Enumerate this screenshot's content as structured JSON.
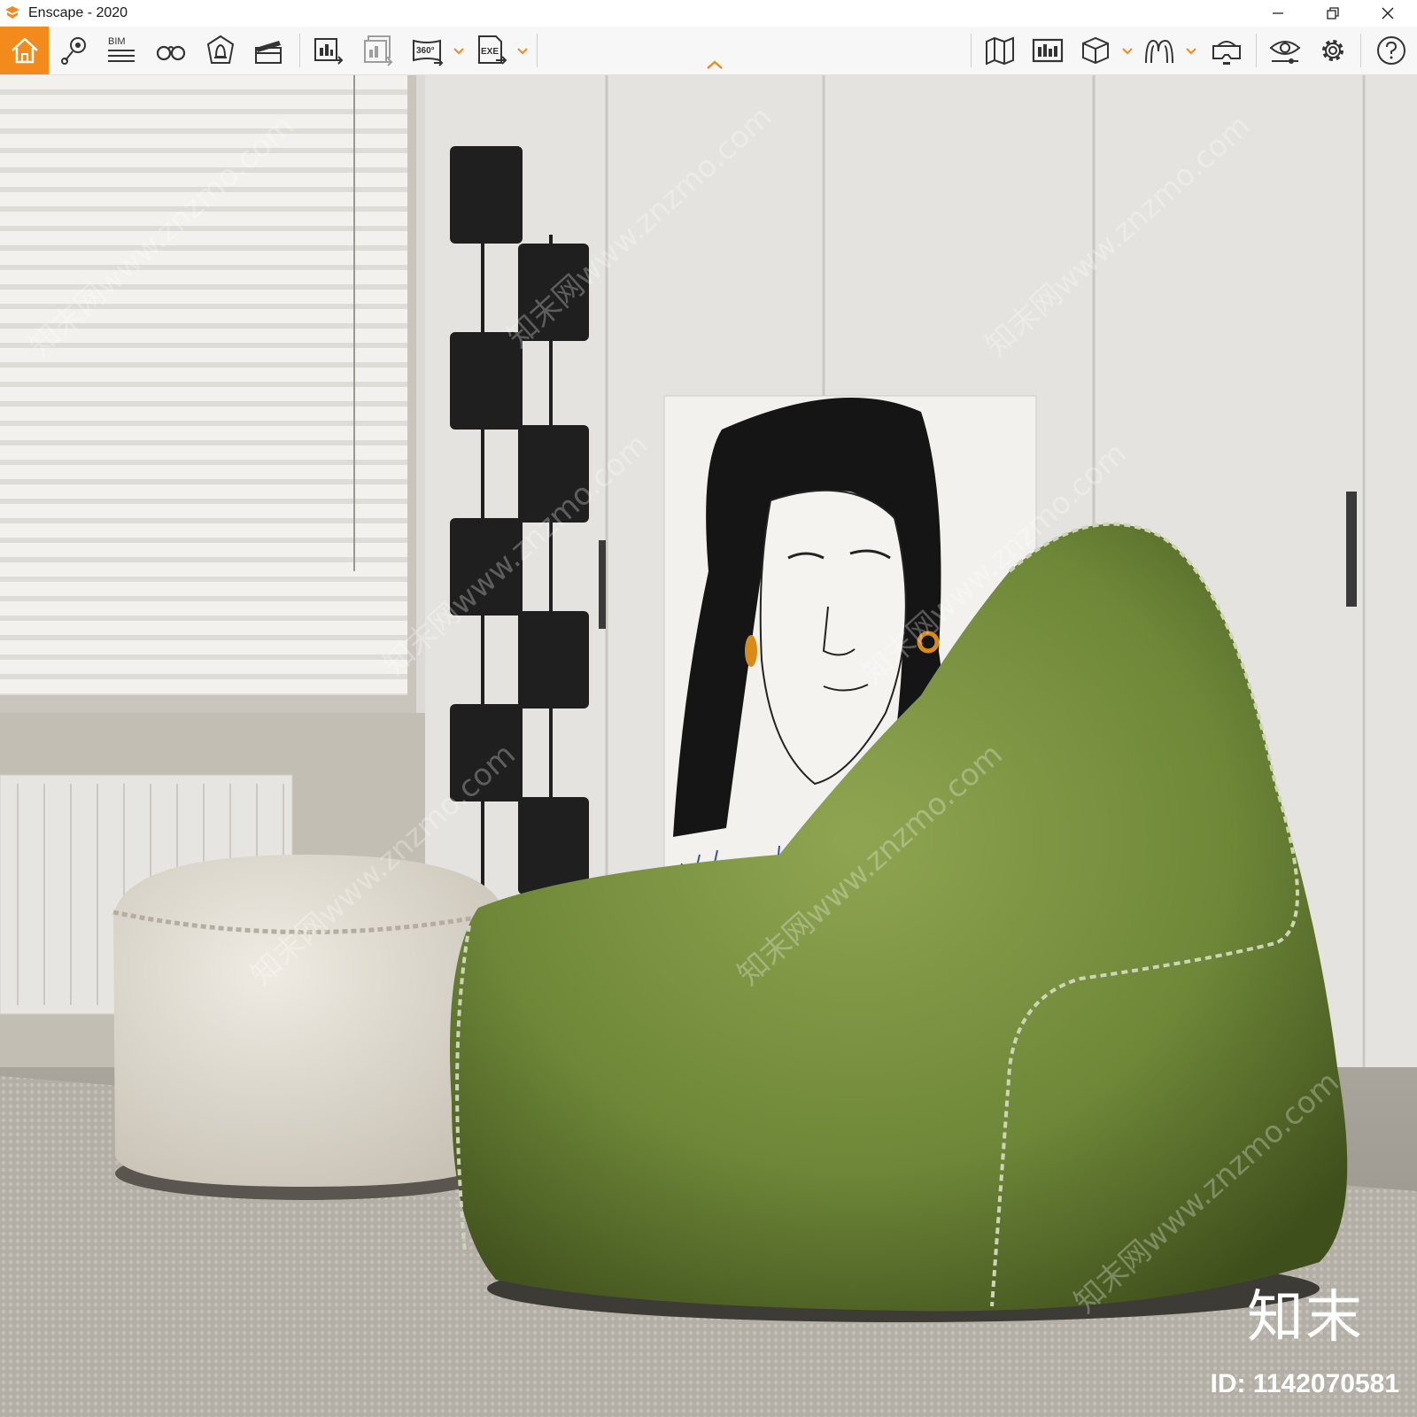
{
  "window": {
    "title": "Enscape - 2020",
    "controls": [
      "minimize",
      "restore",
      "close"
    ]
  },
  "toolbar": {
    "accent_color": "#f28a1c",
    "left_tools": [
      {
        "name": "home",
        "icon": "home-icon",
        "active": true
      },
      {
        "name": "views",
        "icon": "map-pin-icon"
      },
      {
        "name": "bim",
        "icon": "bim-icon",
        "label": "BIM"
      },
      {
        "name": "look-around",
        "icon": "binoculars-icon"
      },
      {
        "name": "atmosphere",
        "icon": "shield-bell-icon"
      },
      {
        "name": "video-editor",
        "icon": "clapperboard-icon"
      },
      {
        "name": "render-image",
        "icon": "render-export-icon"
      },
      {
        "name": "batch-render",
        "icon": "batch-render-icon"
      },
      {
        "name": "panorama",
        "icon": "panorama-icon",
        "label": "360°"
      },
      {
        "name": "export",
        "icon": "exe-export-icon",
        "label": "EXE"
      }
    ],
    "right_tools": [
      {
        "name": "minimap",
        "icon": "map-icon"
      },
      {
        "name": "asset-library",
        "icon": "asset-library-icon"
      },
      {
        "name": "material-editor",
        "icon": "cube-icon"
      },
      {
        "name": "sketch-mode",
        "icon": "sketch-icon"
      },
      {
        "name": "vr-headset",
        "icon": "vr-headset-icon"
      },
      {
        "name": "visual-settings",
        "icon": "eye-settings-icon"
      },
      {
        "name": "general-settings",
        "icon": "gear-icon"
      },
      {
        "name": "help",
        "icon": "help-icon"
      }
    ]
  },
  "viewport": {
    "watermark_text": "知末网www.znzmo.com",
    "brand_mark": "知末",
    "image_id": "ID: 1142070581"
  }
}
